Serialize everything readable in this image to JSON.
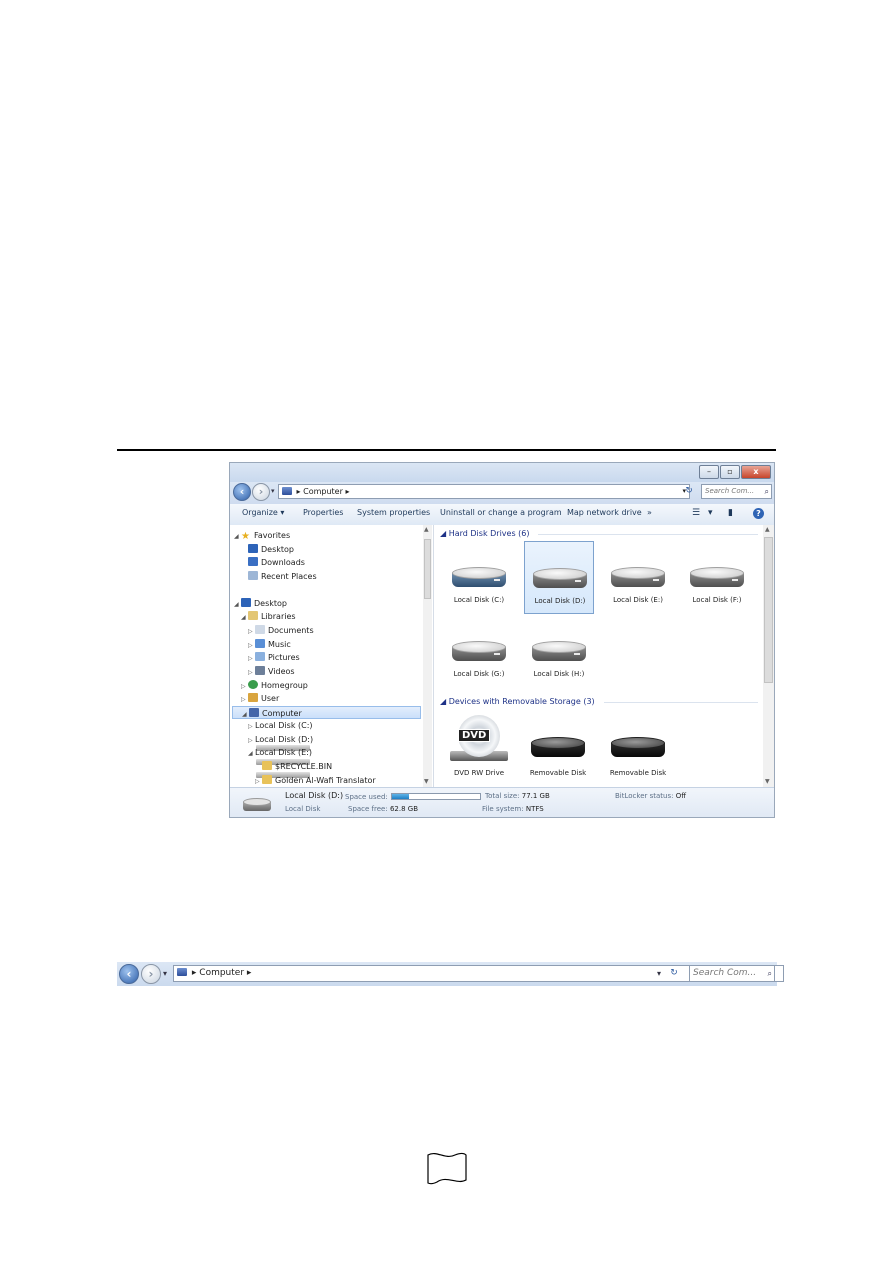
{
  "window": {
    "caption_buttons": {
      "minimize": "–",
      "maximize": "▫",
      "close": "x"
    },
    "address": {
      "path": "Computer",
      "separator": "▸",
      "icon": "computer-icon"
    },
    "search": {
      "placeholder": "Search Com..."
    },
    "toolbar": {
      "organize": "Organize",
      "properties": "Properties",
      "system_properties": "System properties",
      "uninstall": "Uninstall or change a program",
      "map_drive": "Map network drive",
      "more": "»",
      "help": "?"
    },
    "nav_pane": {
      "items": [
        {
          "label": "Favorites",
          "icon": "star-icon",
          "indent": 0,
          "tri": "◢"
        },
        {
          "label": "Desktop",
          "icon": "desktop-icon",
          "indent": 1,
          "tri": ""
        },
        {
          "label": "Downloads",
          "icon": "downloads-icon",
          "indent": 1,
          "tri": ""
        },
        {
          "label": "Recent Places",
          "icon": "recent-places-icon",
          "indent": 1,
          "tri": ""
        },
        {
          "label": "Desktop",
          "icon": "desktop-icon",
          "indent": 0,
          "tri": "◢"
        },
        {
          "label": "Libraries",
          "icon": "libraries-icon",
          "indent": 1,
          "tri": "◢"
        },
        {
          "label": "Documents",
          "icon": "documents-icon",
          "indent": 2,
          "tri": "▷"
        },
        {
          "label": "Music",
          "icon": "music-icon",
          "indent": 2,
          "tri": "▷"
        },
        {
          "label": "Pictures",
          "icon": "pictures-icon",
          "indent": 2,
          "tri": "▷"
        },
        {
          "label": "Videos",
          "icon": "videos-icon",
          "indent": 2,
          "tri": "▷"
        },
        {
          "label": "Homegroup",
          "icon": "homegroup-icon",
          "indent": 1,
          "tri": "▷"
        },
        {
          "label": "User",
          "icon": "user-icon",
          "indent": 1,
          "tri": "▷"
        },
        {
          "label": "Computer",
          "icon": "computer-icon",
          "indent": 1,
          "tri": "◢",
          "selected": true
        },
        {
          "label": "Local Disk (C:)",
          "icon": "drive-icon",
          "indent": 2,
          "tri": "▷"
        },
        {
          "label": "Local Disk (D:)",
          "icon": "drive-icon",
          "indent": 2,
          "tri": "▷"
        },
        {
          "label": "Local Disk (E:)",
          "icon": "drive-icon",
          "indent": 2,
          "tri": "◢"
        },
        {
          "label": "$RECYCLE.BIN",
          "icon": "folder-icon",
          "indent": 3,
          "tri": ""
        },
        {
          "label": "Golden Al-Wafi Translator",
          "icon": "folder-icon",
          "indent": 3,
          "tri": "▷"
        }
      ]
    },
    "content": {
      "hard_disk_group": "Hard Disk Drives (6)",
      "removable_group": "Devices with Removable Storage (3)",
      "hard_disks": [
        {
          "label": "Local Disk (C:)",
          "system": true
        },
        {
          "label": "Local Disk (D:)",
          "selected": true
        },
        {
          "label": "Local Disk (E:)"
        },
        {
          "label": "Local Disk (F:)"
        },
        {
          "label": "Local Disk (G:)"
        },
        {
          "label": "Local Disk (H:)"
        }
      ],
      "removable": [
        {
          "label": "DVD RW Drive",
          "badge": "DVD"
        },
        {
          "label": "Removable Disk"
        },
        {
          "label": "Removable Disk"
        }
      ]
    },
    "details": {
      "title": "Local Disk (D:)",
      "type": "Local Disk",
      "space_used_label": "Space used:",
      "space_used_fraction": 0.19,
      "space_free_label": "Space free:",
      "space_free": "62.8 GB",
      "total_size_label": "Total size:",
      "total_size": "77.1 GB",
      "fs_label": "File system:",
      "fs": "NTFS",
      "bitlocker_label": "BitLocker status:",
      "bitlocker": "Off"
    }
  },
  "strip": {
    "path": "Computer",
    "separator": "▸",
    "search_placeholder": "Search Com..."
  }
}
